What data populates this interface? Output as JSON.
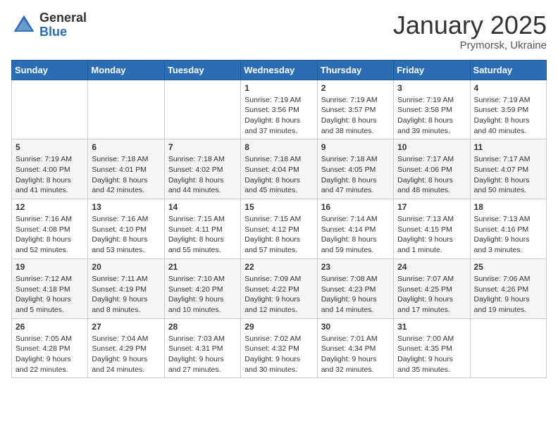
{
  "logo": {
    "general": "General",
    "blue": "Blue"
  },
  "header": {
    "month": "January 2025",
    "location": "Prymorsk, Ukraine"
  },
  "days_of_week": [
    "Sunday",
    "Monday",
    "Tuesday",
    "Wednesday",
    "Thursday",
    "Friday",
    "Saturday"
  ],
  "weeks": [
    [
      {
        "day": "",
        "content": ""
      },
      {
        "day": "",
        "content": ""
      },
      {
        "day": "",
        "content": ""
      },
      {
        "day": "1",
        "content": "Sunrise: 7:19 AM\nSunset: 3:56 PM\nDaylight: 8 hours and 37 minutes."
      },
      {
        "day": "2",
        "content": "Sunrise: 7:19 AM\nSunset: 3:57 PM\nDaylight: 8 hours and 38 minutes."
      },
      {
        "day": "3",
        "content": "Sunrise: 7:19 AM\nSunset: 3:58 PM\nDaylight: 8 hours and 39 minutes."
      },
      {
        "day": "4",
        "content": "Sunrise: 7:19 AM\nSunset: 3:59 PM\nDaylight: 8 hours and 40 minutes."
      }
    ],
    [
      {
        "day": "5",
        "content": "Sunrise: 7:19 AM\nSunset: 4:00 PM\nDaylight: 8 hours and 41 minutes."
      },
      {
        "day": "6",
        "content": "Sunrise: 7:18 AM\nSunset: 4:01 PM\nDaylight: 8 hours and 42 minutes."
      },
      {
        "day": "7",
        "content": "Sunrise: 7:18 AM\nSunset: 4:02 PM\nDaylight: 8 hours and 44 minutes."
      },
      {
        "day": "8",
        "content": "Sunrise: 7:18 AM\nSunset: 4:04 PM\nDaylight: 8 hours and 45 minutes."
      },
      {
        "day": "9",
        "content": "Sunrise: 7:18 AM\nSunset: 4:05 PM\nDaylight: 8 hours and 47 minutes."
      },
      {
        "day": "10",
        "content": "Sunrise: 7:17 AM\nSunset: 4:06 PM\nDaylight: 8 hours and 48 minutes."
      },
      {
        "day": "11",
        "content": "Sunrise: 7:17 AM\nSunset: 4:07 PM\nDaylight: 8 hours and 50 minutes."
      }
    ],
    [
      {
        "day": "12",
        "content": "Sunrise: 7:16 AM\nSunset: 4:08 PM\nDaylight: 8 hours and 52 minutes."
      },
      {
        "day": "13",
        "content": "Sunrise: 7:16 AM\nSunset: 4:10 PM\nDaylight: 8 hours and 53 minutes."
      },
      {
        "day": "14",
        "content": "Sunrise: 7:15 AM\nSunset: 4:11 PM\nDaylight: 8 hours and 55 minutes."
      },
      {
        "day": "15",
        "content": "Sunrise: 7:15 AM\nSunset: 4:12 PM\nDaylight: 8 hours and 57 minutes."
      },
      {
        "day": "16",
        "content": "Sunrise: 7:14 AM\nSunset: 4:14 PM\nDaylight: 8 hours and 59 minutes."
      },
      {
        "day": "17",
        "content": "Sunrise: 7:13 AM\nSunset: 4:15 PM\nDaylight: 9 hours and 1 minute."
      },
      {
        "day": "18",
        "content": "Sunrise: 7:13 AM\nSunset: 4:16 PM\nDaylight: 9 hours and 3 minutes."
      }
    ],
    [
      {
        "day": "19",
        "content": "Sunrise: 7:12 AM\nSunset: 4:18 PM\nDaylight: 9 hours and 5 minutes."
      },
      {
        "day": "20",
        "content": "Sunrise: 7:11 AM\nSunset: 4:19 PM\nDaylight: 9 hours and 8 minutes."
      },
      {
        "day": "21",
        "content": "Sunrise: 7:10 AM\nSunset: 4:20 PM\nDaylight: 9 hours and 10 minutes."
      },
      {
        "day": "22",
        "content": "Sunrise: 7:09 AM\nSunset: 4:22 PM\nDaylight: 9 hours and 12 minutes."
      },
      {
        "day": "23",
        "content": "Sunrise: 7:08 AM\nSunset: 4:23 PM\nDaylight: 9 hours and 14 minutes."
      },
      {
        "day": "24",
        "content": "Sunrise: 7:07 AM\nSunset: 4:25 PM\nDaylight: 9 hours and 17 minutes."
      },
      {
        "day": "25",
        "content": "Sunrise: 7:06 AM\nSunset: 4:26 PM\nDaylight: 9 hours and 19 minutes."
      }
    ],
    [
      {
        "day": "26",
        "content": "Sunrise: 7:05 AM\nSunset: 4:28 PM\nDaylight: 9 hours and 22 minutes."
      },
      {
        "day": "27",
        "content": "Sunrise: 7:04 AM\nSunset: 4:29 PM\nDaylight: 9 hours and 24 minutes."
      },
      {
        "day": "28",
        "content": "Sunrise: 7:03 AM\nSunset: 4:31 PM\nDaylight: 9 hours and 27 minutes."
      },
      {
        "day": "29",
        "content": "Sunrise: 7:02 AM\nSunset: 4:32 PM\nDaylight: 9 hours and 30 minutes."
      },
      {
        "day": "30",
        "content": "Sunrise: 7:01 AM\nSunset: 4:34 PM\nDaylight: 9 hours and 32 minutes."
      },
      {
        "day": "31",
        "content": "Sunrise: 7:00 AM\nSunset: 4:35 PM\nDaylight: 9 hours and 35 minutes."
      },
      {
        "day": "",
        "content": ""
      }
    ]
  ]
}
